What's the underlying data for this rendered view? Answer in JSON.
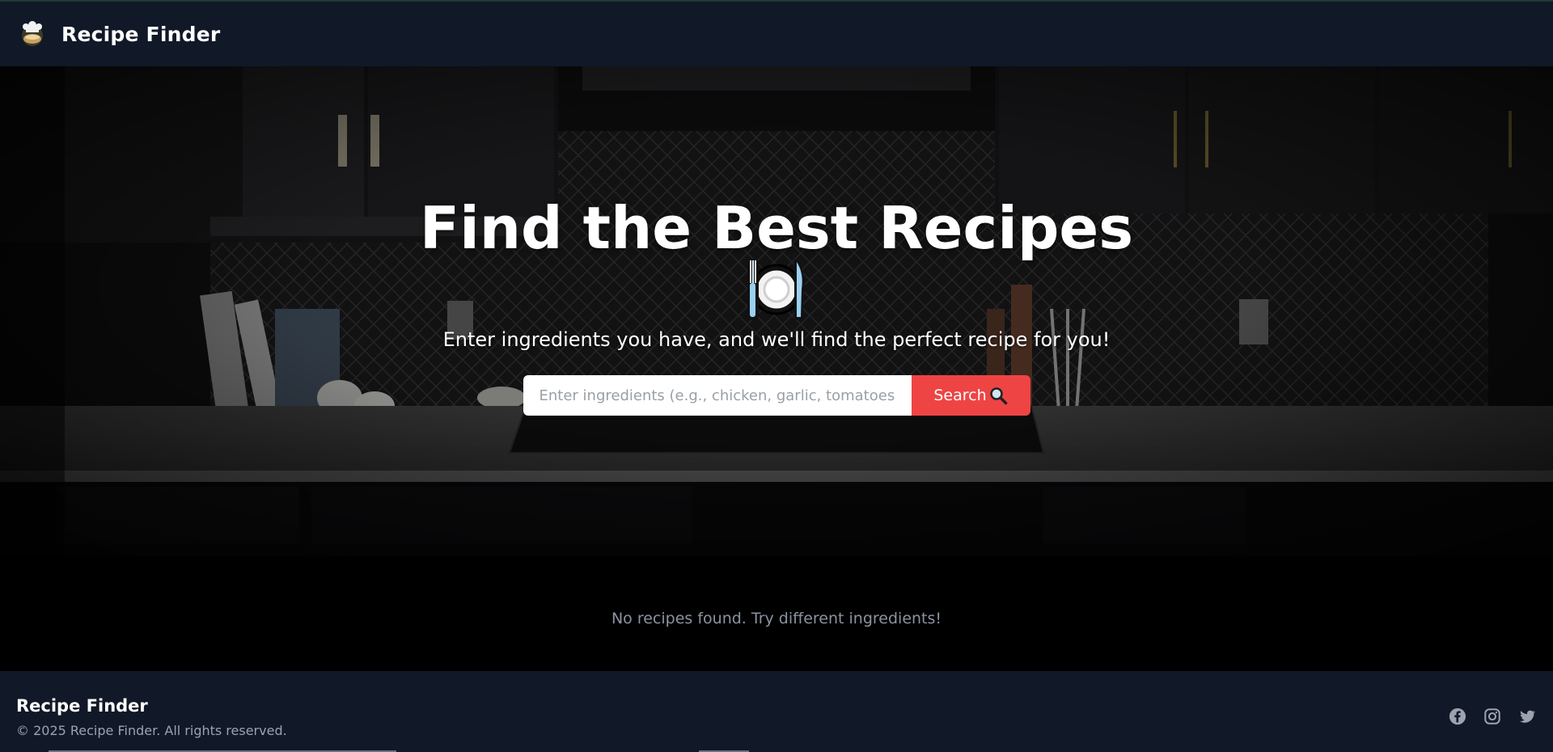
{
  "navbar": {
    "brand": "Recipe Finder",
    "logo_icon": "chef-hat-icon"
  },
  "hero": {
    "title": "Find the Best Recipes",
    "title_icon": "fork-knife-plate-icon",
    "subtitle": "Enter ingredients you have, and we'll find the perfect recipe for you!",
    "search": {
      "placeholder": "Enter ingredients (e.g., chicken, garlic, tomatoes)",
      "value": "",
      "button_label": "Search",
      "button_icon": "magnifier-icon"
    },
    "background": "kitchen-photo"
  },
  "results": {
    "empty_message": "No recipes found. Try different ingredients!"
  },
  "footer": {
    "brand": "Recipe Finder",
    "copyright": "© 2025 Recipe Finder. All rights reserved.",
    "social": [
      {
        "name": "facebook",
        "icon": "facebook-icon"
      },
      {
        "name": "instagram",
        "icon": "instagram-icon"
      },
      {
        "name": "twitter",
        "icon": "twitter-icon"
      }
    ]
  },
  "colors": {
    "navbar_bg": "#111827",
    "accent": "#ef4444",
    "muted_text": "#8b93a1"
  }
}
